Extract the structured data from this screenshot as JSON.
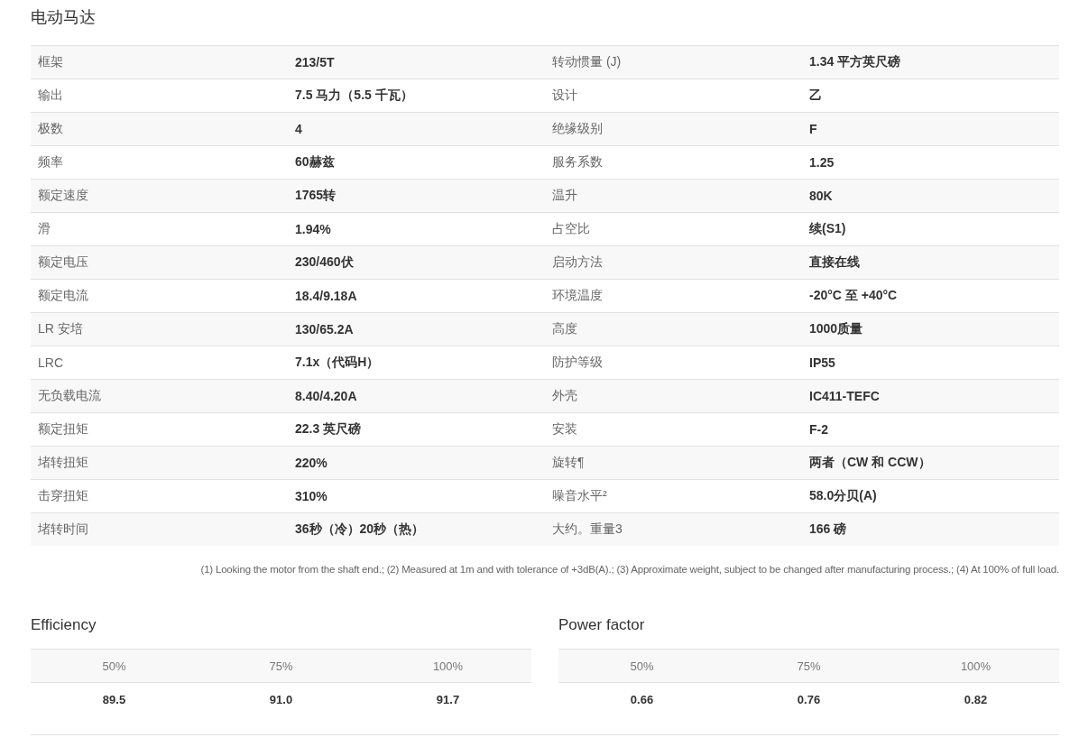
{
  "title": "电动马达",
  "specs": [
    {
      "label": "框架",
      "value": "213/5T",
      "label_2": "转动惯量 (J)",
      "value_2": "1.34 平方英尺磅"
    },
    {
      "label": "输出",
      "value": "7.5 马力（5.5 千瓦）",
      "label_2": "设计",
      "value_2": "乙"
    },
    {
      "label": "极数",
      "value": "4",
      "label_2": "绝缘级别",
      "value_2": "F"
    },
    {
      "label": "频率",
      "value": "60赫兹",
      "label_2": "服务系数",
      "value_2": "1.25"
    },
    {
      "label": "额定速度",
      "value": "1765转",
      "label_2": "温升",
      "value_2": "80K"
    },
    {
      "label": "滑",
      "value": "1.94%",
      "label_2": "占空比",
      "value_2": "续(S1)"
    },
    {
      "label": "额定电压",
      "value": "230/460伏",
      "label_2": "启动方法",
      "value_2": "直接在线"
    },
    {
      "label": "额定电流",
      "value": "18.4/9.18A",
      "label_2": "环境温度",
      "value_2": "-20°C 至 +40°C"
    },
    {
      "label": "LR 安培",
      "value": "130/65.2A",
      "label_2": "高度",
      "value_2": "1000质量"
    },
    {
      "label": "LRC",
      "value": "7.1x（代码H）",
      "label_2": "防护等级",
      "value_2": "IP55"
    },
    {
      "label": "无负载电流",
      "value": "8.40/4.20A",
      "label_2": "外壳",
      "value_2": "IC411-TEFC"
    },
    {
      "label": "额定扭矩",
      "value": "22.3 英尺磅",
      "label_2": "安装",
      "value_2": "F-2"
    },
    {
      "label": "堵转扭矩",
      "value": "220%",
      "label_2": "旋转¶",
      "value_2": "两者（CW 和 CCW）"
    },
    {
      "label": "击穿扭矩",
      "value": "310%",
      "label_2": "噪音水平²",
      "value_2": "58.0分贝(A)"
    },
    {
      "label": "堵转时间",
      "value": "36秒（冷）20秒（热）",
      "label_2": "大约。重量3",
      "value_2": "166 磅"
    }
  ],
  "footnote": "(1) Looking the motor from the shaft end.; (2) Measured at 1m and with tolerance of +3dB(A).; (3) Approximate weight, subject to be changed after manufacturing process.; (4) At 100% of full load.",
  "load_tables": [
    {
      "title": "Efficiency",
      "columns": [
        "50%",
        "75%",
        "100%"
      ],
      "values": [
        "89.5",
        "91.0",
        "91.7"
      ]
    },
    {
      "title": "Power factor",
      "columns": [
        "50%",
        "75%",
        "100%"
      ],
      "values": [
        "0.66",
        "0.76",
        "0.82"
      ]
    }
  ]
}
